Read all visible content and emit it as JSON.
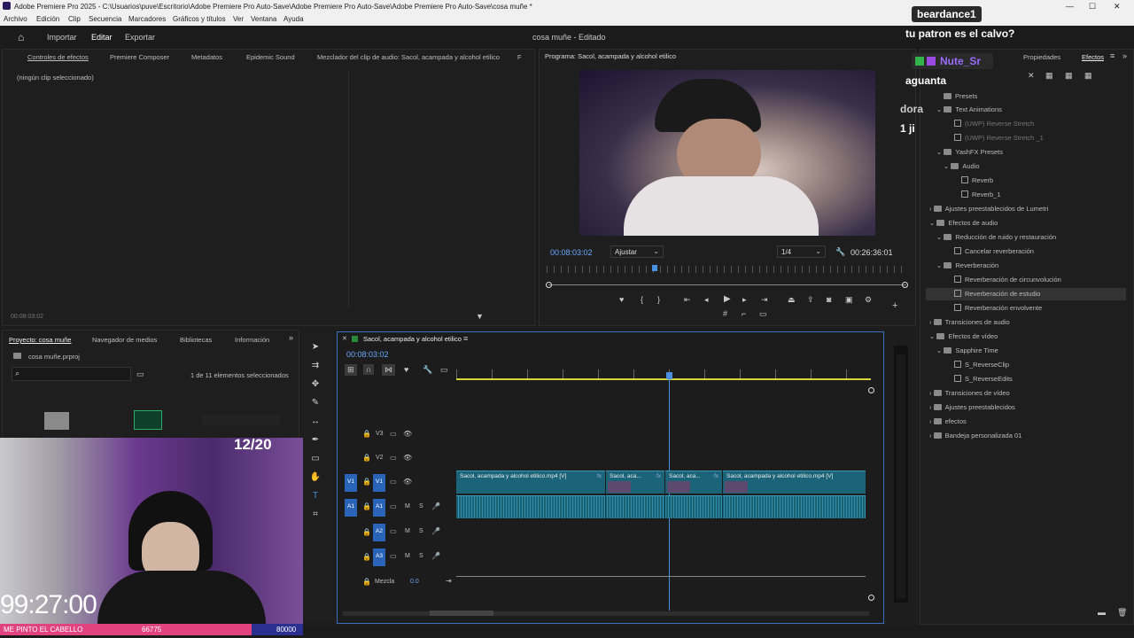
{
  "titlebar": {
    "text": "Adobe Premiere Pro 2025 - C:\\Usuarios\\puve\\Escritorio\\Adobe Premiere Pro Auto-Save\\Adobe Premiere Pro Auto-Save\\Adobe Premiere Pro Auto-Save\\cosa muñe *"
  },
  "menu": [
    "Archivo",
    "Edición",
    "Clip",
    "Secuencia",
    "Marcadores",
    "Gráficos y títulos",
    "Ver",
    "Ventana",
    "Ayuda"
  ],
  "header": {
    "home_icon": "home-icon",
    "import": "Importar",
    "edit": "Editar",
    "export": "Exportar",
    "project_title": "cosa muñe - Editado"
  },
  "source_tabs": [
    "Controles de efectos",
    "Premiere Composer",
    "Metadatos",
    "Epidemic Sound",
    "Mezclador del clip de audio: Sacol, acampada y alcohol etilico",
    "F"
  ],
  "effects_controls": {
    "empty": "(ningún clip seleccionado)",
    "timecode": "00:08:03:02"
  },
  "program": {
    "title": "Programa: Sacol, acampada y alcohol etilico",
    "timecode": "00:08:03:02",
    "fit": "Ajustar",
    "quality": "1/4",
    "duration": "00:26:36:01"
  },
  "right_tabs": {
    "properties": "Propiedades",
    "effects": "Efectos"
  },
  "effects_tree": [
    {
      "label": "Presets",
      "type": "folder"
    },
    {
      "label": "Text Animations",
      "type": "folder"
    },
    {
      "label": "(UWP) Reverse Stretch",
      "type": "fx"
    },
    {
      "label": "(UWP) Reverse Stretch _1",
      "type": "fx"
    },
    {
      "label": "YashFX Presets",
      "type": "folder"
    },
    {
      "label": "Audio",
      "type": "folder"
    },
    {
      "label": "Reverb",
      "type": "fx"
    },
    {
      "label": "Reverb_1",
      "type": "fx"
    },
    {
      "label": "Ajustes preestablecidos de Lumetri",
      "type": "folder"
    },
    {
      "label": "Efectos de audio",
      "type": "folder"
    },
    {
      "label": "Reducción de ruido y restauración",
      "type": "folder"
    },
    {
      "label": "Cancelar reverberación",
      "type": "fx"
    },
    {
      "label": "Reverberación",
      "type": "folder"
    },
    {
      "label": "Reverberación de circunvolución",
      "type": "fx"
    },
    {
      "label": "Reverberación de estudio",
      "type": "fx"
    },
    {
      "label": "Reverberación envolvente",
      "type": "fx"
    },
    {
      "label": "Transiciones de audio",
      "type": "folder"
    },
    {
      "label": "Efectos de vídeo",
      "type": "folder"
    },
    {
      "label": "Sapphire Time",
      "type": "folder"
    },
    {
      "label": "S_ReverseClip",
      "type": "fx"
    },
    {
      "label": "S_ReverseEdits",
      "type": "fx"
    },
    {
      "label": "Transiciones de vídeo",
      "type": "folder"
    },
    {
      "label": "Ajustes preestablecidos",
      "type": "folder"
    },
    {
      "label": "efectos",
      "type": "folder"
    },
    {
      "label": "Bandeja personalizada 01",
      "type": "folder"
    }
  ],
  "project": {
    "tabs": [
      "Proyecto: cosa muñe",
      "Navegador de medios",
      "Bibliotecas",
      "Información"
    ],
    "file": "cosa muñe.prproj",
    "selection": "1 de 11 elementos seleccionados"
  },
  "timeline": {
    "tab": "Sacol, acampada y alcohol etilico",
    "timecode": "00:08:03:02",
    "tracks": {
      "v3": "V3",
      "v2": "V2",
      "v1": "V1",
      "a1": "A1",
      "a2": "A2",
      "a3": "A3",
      "mix": "Mezcla",
      "mix_value": "0.0"
    },
    "clips": [
      "Sacol, acampada y alcohol etilico.mp4 [V]",
      "Sacol, aca...",
      "Sacol, aca...",
      "Sacol, acampada y alcohol etilico.mp4 [V]"
    ],
    "clip_fx": "fx",
    "track_m": "M",
    "track_s": "S"
  },
  "overlay": {
    "counter": "12/20",
    "timer": "99:27:00",
    "bar_left": "ME PINTO EL CABELLO",
    "bar_mid": "66775",
    "bar_right": "80000",
    "chat": [
      {
        "user": "beardance1",
        "msg": "tu patron es el calvo?"
      },
      {
        "user": "Nute_Sr",
        "msg": "aguanta"
      }
    ],
    "partial1": "dora",
    "partial2": "1 ji"
  },
  "colors": {
    "accent": "#3a7bd5",
    "timeline_clip": "#1b6378",
    "playhead": "#4a90e2"
  }
}
